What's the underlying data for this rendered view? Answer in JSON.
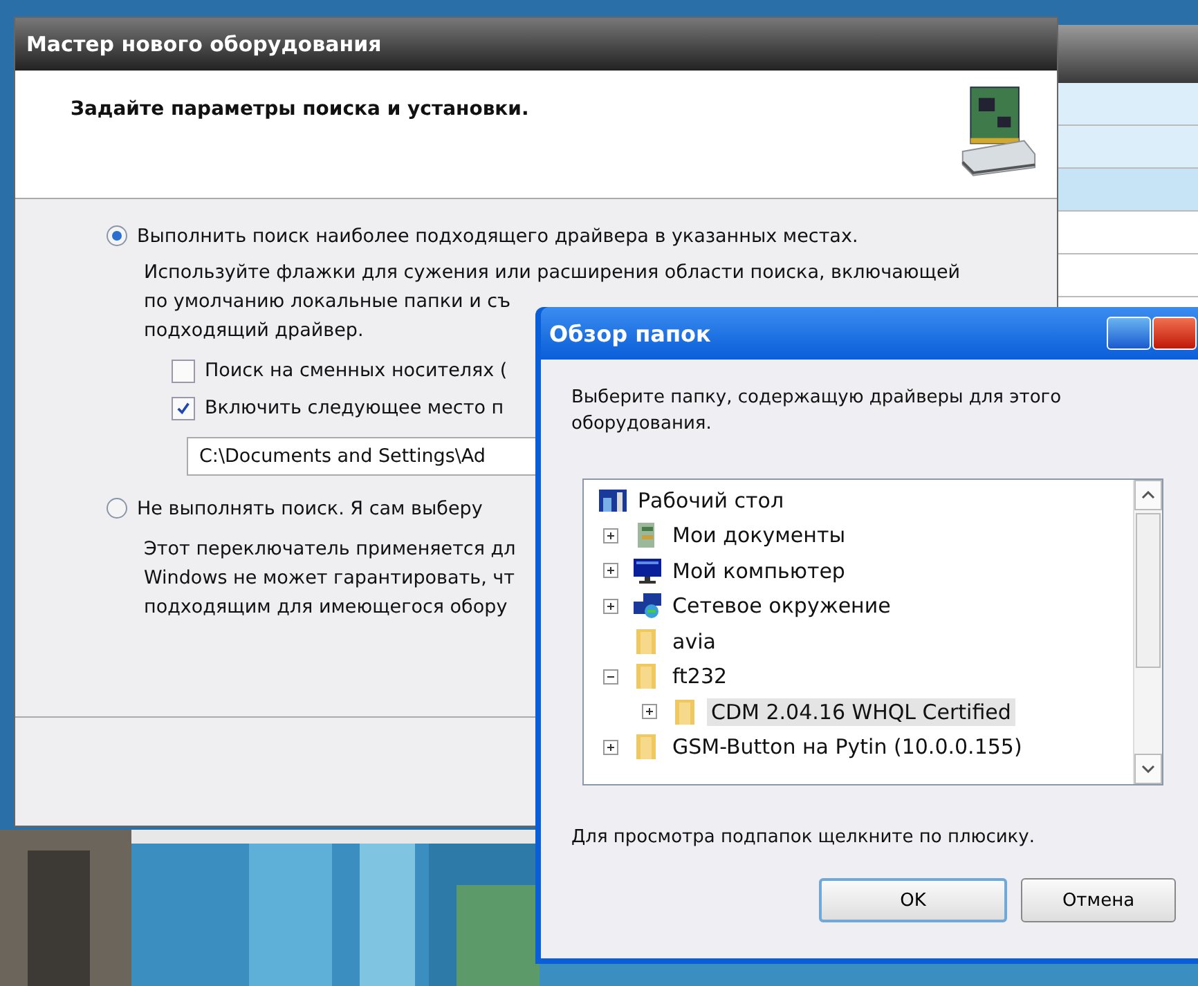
{
  "wizard": {
    "title": "Мастер нового оборудования",
    "heading": "Задайте параметры поиска и установки.",
    "options": [
      {
        "label": "Выполнить поиск наиболее подходящего драйвера в указанных местах.",
        "selected": true,
        "description": [
          "Используйте флажки для сужения или расширения области поиска, включающей",
          "по умолчанию локальные папки и съ",
          "подходящий драйвер."
        ],
        "checkboxes": [
          {
            "label": "Поиск на сменных носителях (",
            "checked": false
          },
          {
            "label": "Включить следующее место п",
            "checked": true
          }
        ],
        "path": "C:\\Documents and Settings\\Ad"
      },
      {
        "label": "Не выполнять поиск. Я сам выберу",
        "selected": false,
        "description": [
          "Этот переключатель применяется дл",
          "Windows не может гарантировать, чт",
          "подходящим для имеющегося обору"
        ]
      }
    ]
  },
  "browse_dialog": {
    "title": "Обзор папок",
    "prompt": "Выберите папку, содержащую драйверы для этого оборудования.",
    "tree": [
      {
        "label": "Рабочий стол",
        "kind": "desktop",
        "expandable": false,
        "selected": false,
        "children": [
          {
            "label": "Мои документы",
            "kind": "documents",
            "expandable": true,
            "expanded": false,
            "selected": false
          },
          {
            "label": "Мой компьютер",
            "kind": "computer",
            "expandable": true,
            "expanded": false,
            "selected": false
          },
          {
            "label": "Сетевое окружение",
            "kind": "network",
            "expandable": true,
            "expanded": false,
            "selected": false
          },
          {
            "label": "avia",
            "kind": "folder",
            "expandable": false,
            "selected": false
          },
          {
            "label": "ft232",
            "kind": "folder",
            "expandable": true,
            "expanded": true,
            "selected": false,
            "children": [
              {
                "label": "CDM 2.04.16 WHQL Certified",
                "kind": "folder",
                "expandable": true,
                "expanded": false,
                "selected": true
              }
            ]
          },
          {
            "label": "GSM-Button на Pytin (10.0.0.155)",
            "kind": "folder",
            "expandable": true,
            "expanded": false,
            "selected": false
          }
        ]
      }
    ],
    "hint": "Для просмотра подпапок щелкните по плюсику.",
    "buttons": [
      {
        "label": "OK",
        "kind": "default"
      },
      {
        "label": "Отмена",
        "kind": "normal"
      }
    ]
  }
}
